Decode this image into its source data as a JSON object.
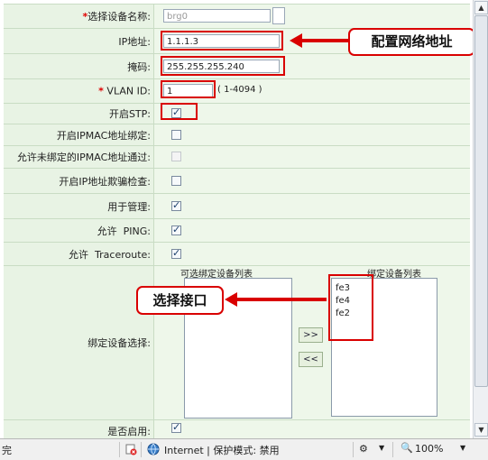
{
  "form": {
    "device_name": {
      "label": "选择设备名称:",
      "value": "brg0"
    },
    "ip": {
      "label": "IP地址:",
      "value": "1.1.1.3"
    },
    "mask": {
      "label": "掩码:",
      "value": "255.255.255.240"
    },
    "vlan": {
      "label": "VLAN ID:",
      "value": "1",
      "range": "( 1-4094 )"
    },
    "stp": {
      "label": "开启STP:",
      "checked": true
    },
    "ipmac_bind": {
      "label": "开启IPMAC地址绑定:",
      "checked": false
    },
    "allow_unbound": {
      "label": "允许未绑定的IPMAC地址通过:",
      "checked": false,
      "disabled": true
    },
    "ip_spoof": {
      "label": "开启IP地址欺骗检查:",
      "checked": false
    },
    "manage": {
      "label": "用于管理:",
      "checked": true
    },
    "ping": {
      "label": "允许  PING:",
      "checked": true
    },
    "traceroute": {
      "label": "允许  Traceroute:",
      "checked": true
    },
    "bind_device": {
      "label": "绑定设备选择:",
      "available_title": "可选绑定设备列表",
      "bound_title": "绑定设备列表",
      "available": [],
      "bound": [
        "fe3",
        "fe4",
        "fe2"
      ],
      "add_label": ">>",
      "remove_label": "<<"
    },
    "enable": {
      "label": "是否启用:",
      "checked": true
    },
    "required_mark": "*"
  },
  "annotations": {
    "config_ip": "配置网络地址",
    "select_iface": "选择接口"
  },
  "status_bar": {
    "left": "完",
    "zone": "Internet | 保护模式: 禁用",
    "zoom": "100%"
  },
  "colors": {
    "accent": "#d90000",
    "label_bg": "#e8f3e4",
    "value_bg": "#eef7ea"
  }
}
